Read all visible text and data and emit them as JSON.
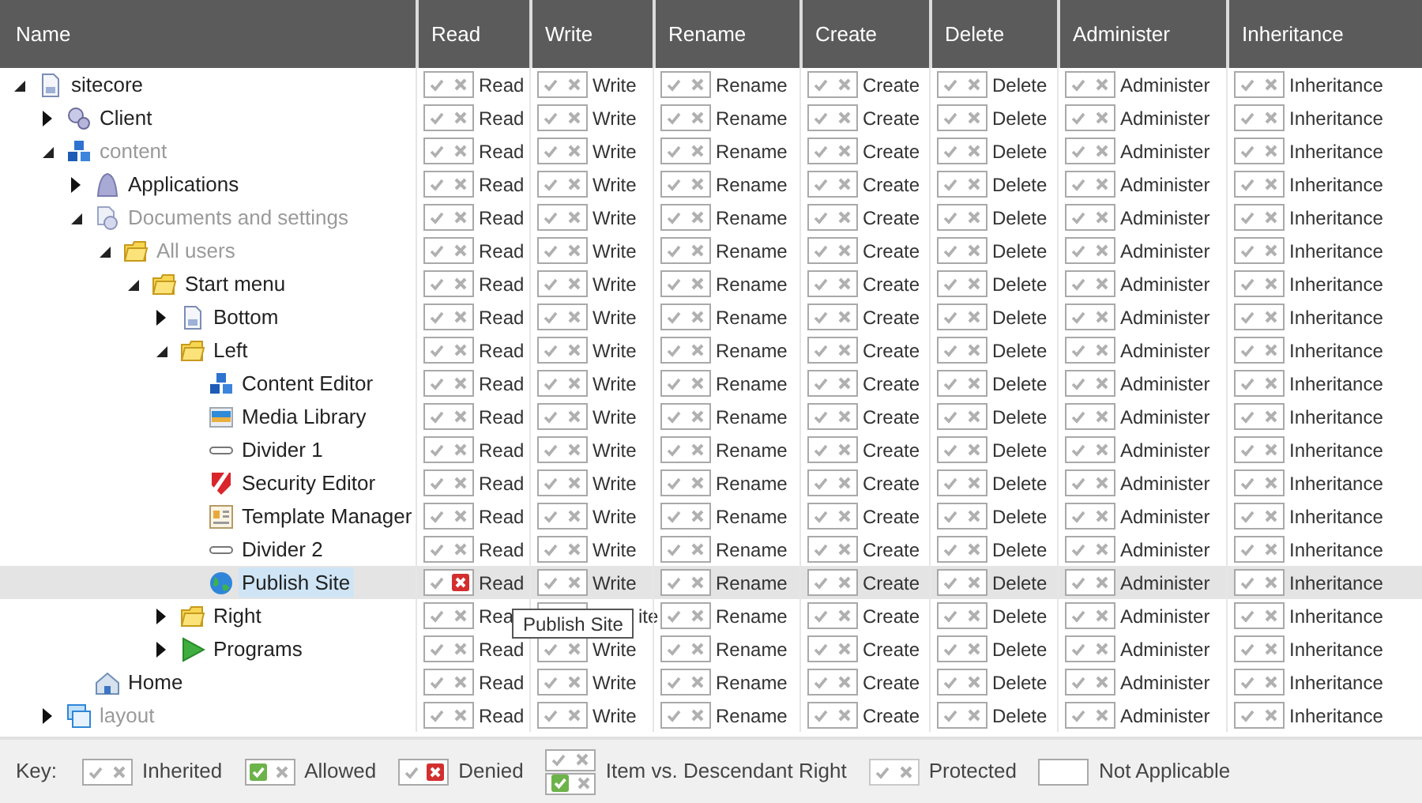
{
  "columns": [
    "Name",
    "Read",
    "Write",
    "Rename",
    "Create",
    "Delete",
    "Administer",
    "Inheritance"
  ],
  "tree": [
    {
      "name": "sitecore",
      "kind": "document",
      "expanded": true,
      "muted": false,
      "selected": false,
      "rights": [
        {
          "label": "Read",
          "denied": false
        },
        {
          "label": "Write",
          "denied": false
        },
        {
          "label": "Rename",
          "denied": false
        },
        {
          "label": "Create",
          "denied": false
        },
        {
          "label": "Delete",
          "denied": false
        },
        {
          "label": "Administer",
          "denied": false
        },
        {
          "label": "Inheritance",
          "denied": false
        }
      ],
      "children": [
        {
          "name": "Client",
          "kind": "gears",
          "expanded": false,
          "muted": false,
          "selected": false,
          "rights": [
            {
              "label": "Read",
              "denied": false
            },
            {
              "label": "Write",
              "denied": false
            },
            {
              "label": "Rename",
              "denied": false
            },
            {
              "label": "Create",
              "denied": false
            },
            {
              "label": "Delete",
              "denied": false
            },
            {
              "label": "Administer",
              "denied": false
            },
            {
              "label": "Inheritance",
              "denied": false
            }
          ]
        },
        {
          "name": "content",
          "kind": "cubes",
          "expanded": true,
          "muted": true,
          "selected": false,
          "rights": [
            {
              "label": "Read",
              "denied": false
            },
            {
              "label": "Write",
              "denied": false
            },
            {
              "label": "Rename",
              "denied": false
            },
            {
              "label": "Create",
              "denied": false
            },
            {
              "label": "Delete",
              "denied": false
            },
            {
              "label": "Administer",
              "denied": false
            },
            {
              "label": "Inheritance",
              "denied": false
            }
          ],
          "children": [
            {
              "name": "Applications",
              "kind": "arch",
              "expanded": false,
              "muted": false,
              "selected": false,
              "rights": [
                {
                  "label": "Read",
                  "denied": false
                },
                {
                  "label": "Write",
                  "denied": false
                },
                {
                  "label": "Rename",
                  "denied": false
                },
                {
                  "label": "Create",
                  "denied": false
                },
                {
                  "label": "Delete",
                  "denied": false
                },
                {
                  "label": "Administer",
                  "denied": false
                },
                {
                  "label": "Inheritance",
                  "denied": false
                }
              ]
            },
            {
              "name": "Documents and settings",
              "kind": "docgear",
              "expanded": true,
              "muted": true,
              "selected": false,
              "rights": [
                {
                  "label": "Read",
                  "denied": false
                },
                {
                  "label": "Write",
                  "denied": false
                },
                {
                  "label": "Rename",
                  "denied": false
                },
                {
                  "label": "Create",
                  "denied": false
                },
                {
                  "label": "Delete",
                  "denied": false
                },
                {
                  "label": "Administer",
                  "denied": false
                },
                {
                  "label": "Inheritance",
                  "denied": false
                }
              ],
              "children": [
                {
                  "name": "All users",
                  "kind": "folder",
                  "expanded": true,
                  "muted": true,
                  "selected": false,
                  "rights": [
                    {
                      "label": "Read",
                      "denied": false
                    },
                    {
                      "label": "Write",
                      "denied": false
                    },
                    {
                      "label": "Rename",
                      "denied": false
                    },
                    {
                      "label": "Create",
                      "denied": false
                    },
                    {
                      "label": "Delete",
                      "denied": false
                    },
                    {
                      "label": "Administer",
                      "denied": false
                    },
                    {
                      "label": "Inheritance",
                      "denied": false
                    }
                  ],
                  "children": [
                    {
                      "name": "Start menu",
                      "kind": "folder",
                      "expanded": true,
                      "muted": false,
                      "selected": false,
                      "rights": [
                        {
                          "label": "Read",
                          "denied": false
                        },
                        {
                          "label": "Write",
                          "denied": false
                        },
                        {
                          "label": "Rename",
                          "denied": false
                        },
                        {
                          "label": "Create",
                          "denied": false
                        },
                        {
                          "label": "Delete",
                          "denied": false
                        },
                        {
                          "label": "Administer",
                          "denied": false
                        },
                        {
                          "label": "Inheritance",
                          "denied": false
                        }
                      ],
                      "children": [
                        {
                          "name": "Bottom",
                          "kind": "document",
                          "expanded": false,
                          "muted": false,
                          "selected": false,
                          "rights": [
                            {
                              "label": "Read",
                              "denied": false
                            },
                            {
                              "label": "Write",
                              "denied": false
                            },
                            {
                              "label": "Rename",
                              "denied": false
                            },
                            {
                              "label": "Create",
                              "denied": false
                            },
                            {
                              "label": "Delete",
                              "denied": false
                            },
                            {
                              "label": "Administer",
                              "denied": false
                            },
                            {
                              "label": "Inheritance",
                              "denied": false
                            }
                          ]
                        },
                        {
                          "name": "Left",
                          "kind": "folder",
                          "expanded": true,
                          "muted": false,
                          "selected": false,
                          "rights": [
                            {
                              "label": "Read",
                              "denied": false
                            },
                            {
                              "label": "Write",
                              "denied": false
                            },
                            {
                              "label": "Rename",
                              "denied": false
                            },
                            {
                              "label": "Create",
                              "denied": false
                            },
                            {
                              "label": "Delete",
                              "denied": false
                            },
                            {
                              "label": "Administer",
                              "denied": false
                            },
                            {
                              "label": "Inheritance",
                              "denied": false
                            }
                          ],
                          "children": [
                            {
                              "name": "Content Editor",
                              "kind": "cubes",
                              "muted": false,
                              "selected": false,
                              "rights": [
                                {
                                  "label": "Read",
                                  "denied": false
                                },
                                {
                                  "label": "Write",
                                  "denied": false
                                },
                                {
                                  "label": "Rename",
                                  "denied": false
                                },
                                {
                                  "label": "Create",
                                  "denied": false
                                },
                                {
                                  "label": "Delete",
                                  "denied": false
                                },
                                {
                                  "label": "Administer",
                                  "denied": false
                                },
                                {
                                  "label": "Inheritance",
                                  "denied": false
                                }
                              ]
                            },
                            {
                              "name": "Media Library",
                              "kind": "media",
                              "muted": false,
                              "selected": false,
                              "rights": [
                                {
                                  "label": "Read",
                                  "denied": false
                                },
                                {
                                  "label": "Write",
                                  "denied": false
                                },
                                {
                                  "label": "Rename",
                                  "denied": false
                                },
                                {
                                  "label": "Create",
                                  "denied": false
                                },
                                {
                                  "label": "Delete",
                                  "denied": false
                                },
                                {
                                  "label": "Administer",
                                  "denied": false
                                },
                                {
                                  "label": "Inheritance",
                                  "denied": false
                                }
                              ]
                            },
                            {
                              "name": "Divider 1",
                              "kind": "divider",
                              "muted": false,
                              "selected": false,
                              "rights": [
                                {
                                  "label": "Read",
                                  "denied": false
                                },
                                {
                                  "label": "Write",
                                  "denied": false
                                },
                                {
                                  "label": "Rename",
                                  "denied": false
                                },
                                {
                                  "label": "Create",
                                  "denied": false
                                },
                                {
                                  "label": "Delete",
                                  "denied": false
                                },
                                {
                                  "label": "Administer",
                                  "denied": false
                                },
                                {
                                  "label": "Inheritance",
                                  "denied": false
                                }
                              ]
                            },
                            {
                              "name": "Security Editor",
                              "kind": "shield",
                              "muted": false,
                              "selected": false,
                              "rights": [
                                {
                                  "label": "Read",
                                  "denied": false
                                },
                                {
                                  "label": "Write",
                                  "denied": false
                                },
                                {
                                  "label": "Rename",
                                  "denied": false
                                },
                                {
                                  "label": "Create",
                                  "denied": false
                                },
                                {
                                  "label": "Delete",
                                  "denied": false
                                },
                                {
                                  "label": "Administer",
                                  "denied": false
                                },
                                {
                                  "label": "Inheritance",
                                  "denied": false
                                }
                              ]
                            },
                            {
                              "name": "Template Manager",
                              "kind": "template",
                              "muted": false,
                              "selected": false,
                              "rights": [
                                {
                                  "label": "Read",
                                  "denied": false
                                },
                                {
                                  "label": "Write",
                                  "denied": false
                                },
                                {
                                  "label": "Rename",
                                  "denied": false
                                },
                                {
                                  "label": "Create",
                                  "denied": false
                                },
                                {
                                  "label": "Delete",
                                  "denied": false
                                },
                                {
                                  "label": "Administer",
                                  "denied": false
                                },
                                {
                                  "label": "Inheritance",
                                  "denied": false
                                }
                              ]
                            },
                            {
                              "name": "Divider 2",
                              "kind": "divider",
                              "muted": false,
                              "selected": false,
                              "rights": [
                                {
                                  "label": "Read",
                                  "denied": false
                                },
                                {
                                  "label": "Write",
                                  "denied": false
                                },
                                {
                                  "label": "Rename",
                                  "denied": false
                                },
                                {
                                  "label": "Create",
                                  "denied": false
                                },
                                {
                                  "label": "Delete",
                                  "denied": false
                                },
                                {
                                  "label": "Administer",
                                  "denied": false
                                },
                                {
                                  "label": "Inheritance",
                                  "denied": false
                                }
                              ]
                            },
                            {
                              "name": "Publish Site",
                              "kind": "globe",
                              "muted": false,
                              "selected": true,
                              "rights": [
                                {
                                  "label": "Read",
                                  "denied": true
                                },
                                {
                                  "label": "Write",
                                  "denied": false
                                },
                                {
                                  "label": "Rename",
                                  "denied": false
                                },
                                {
                                  "label": "Create",
                                  "denied": false
                                },
                                {
                                  "label": "Delete",
                                  "denied": false
                                },
                                {
                                  "label": "Administer",
                                  "denied": false
                                },
                                {
                                  "label": "Inheritance",
                                  "denied": false
                                }
                              ]
                            }
                          ]
                        },
                        {
                          "name": "Right",
                          "kind": "folder",
                          "expanded": false,
                          "muted": false,
                          "selected": false,
                          "rights": [
                            {
                              "label": "Rea",
                              "denied": false
                            },
                            {
                              "label": "ite",
                              "kind": "tail"
                            },
                            {
                              "label": "Rename",
                              "denied": false
                            },
                            {
                              "label": "Create",
                              "denied": false
                            },
                            {
                              "label": "Delete",
                              "denied": false
                            },
                            {
                              "label": "Administer",
                              "denied": false
                            },
                            {
                              "label": "Inheritance",
                              "denied": false
                            }
                          ]
                        },
                        {
                          "name": "Programs",
                          "kind": "play",
                          "expanded": false,
                          "muted": false,
                          "selected": false,
                          "rights": [
                            {
                              "label": "Read",
                              "denied": false
                            },
                            {
                              "label": "Write",
                              "denied": false
                            },
                            {
                              "label": "Rename",
                              "denied": false
                            },
                            {
                              "label": "Create",
                              "denied": false
                            },
                            {
                              "label": "Delete",
                              "denied": false
                            },
                            {
                              "label": "Administer",
                              "denied": false
                            },
                            {
                              "label": "Inheritance",
                              "denied": false
                            }
                          ]
                        }
                      ]
                    }
                  ]
                }
              ]
            },
            {
              "name": "Home",
              "kind": "home",
              "muted": false,
              "selected": false,
              "rights": [
                {
                  "label": "Read",
                  "denied": false
                },
                {
                  "label": "Write",
                  "denied": false
                },
                {
                  "label": "Rename",
                  "denied": false
                },
                {
                  "label": "Create",
                  "denied": false
                },
                {
                  "label": "Delete",
                  "denied": false
                },
                {
                  "label": "Administer",
                  "denied": false
                },
                {
                  "label": "Inheritance",
                  "denied": false
                }
              ]
            }
          ]
        },
        {
          "name": "layout",
          "kind": "windows",
          "expanded": false,
          "muted": true,
          "selected": false,
          "rights": [
            {
              "label": "Read",
              "denied": false
            },
            {
              "label": "Write",
              "denied": false
            },
            {
              "label": "Rename",
              "denied": false
            },
            {
              "label": "Create",
              "denied": false
            },
            {
              "label": "Delete",
              "denied": false
            },
            {
              "label": "Administer",
              "denied": false
            },
            {
              "label": "Inheritance",
              "denied": false
            }
          ]
        }
      ]
    }
  ],
  "tooltip": {
    "text": "Publish Site"
  },
  "key": {
    "label": "Key:",
    "items": [
      {
        "kind": "inherited",
        "label": "Inherited"
      },
      {
        "kind": "allowed",
        "label": "Allowed"
      },
      {
        "kind": "denied",
        "label": "Denied"
      },
      {
        "kind": "item_vs_descendant",
        "label": "Item vs. Descendant Right"
      },
      {
        "kind": "protected",
        "label": "Protected"
      },
      {
        "kind": "not_applicable",
        "label": "Not Applicable"
      }
    ]
  }
}
